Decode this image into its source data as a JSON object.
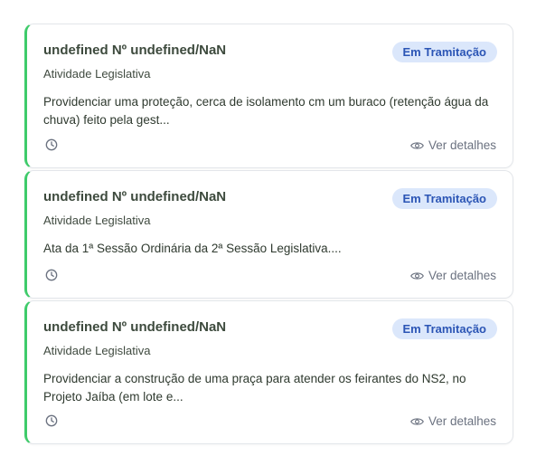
{
  "cards": [
    {
      "title": "undefined Nº undefined/NaN",
      "category": "Atividade Legislativa",
      "status": "Em Tramitação",
      "description": "Providenciar uma proteção, cerca de isolamento cm um buraco (retenção água da chuva) feito pela gest...",
      "details_label": "Ver detalhes"
    },
    {
      "title": "undefined Nº undefined/NaN",
      "category": "Atividade Legislativa",
      "status": "Em Tramitação",
      "description": "Ata da 1ª Sessão Ordinária da 2ª Sessão Legislativa....",
      "details_label": "Ver detalhes"
    },
    {
      "title": "undefined Nº undefined/NaN",
      "category": "Atividade Legislativa",
      "status": "Em Tramitação",
      "description": "Providenciar a construção de uma praça para atender os feirantes do NS2, no Projeto Jaíba (em lote e...",
      "details_label": "Ver detalhes"
    }
  ],
  "colors": {
    "accent_border": "#3ecb6a",
    "badge_bg": "#dbe7fb",
    "badge_text": "#2b55b5"
  },
  "icons": {
    "time": "clock-icon",
    "view": "eye-icon"
  }
}
